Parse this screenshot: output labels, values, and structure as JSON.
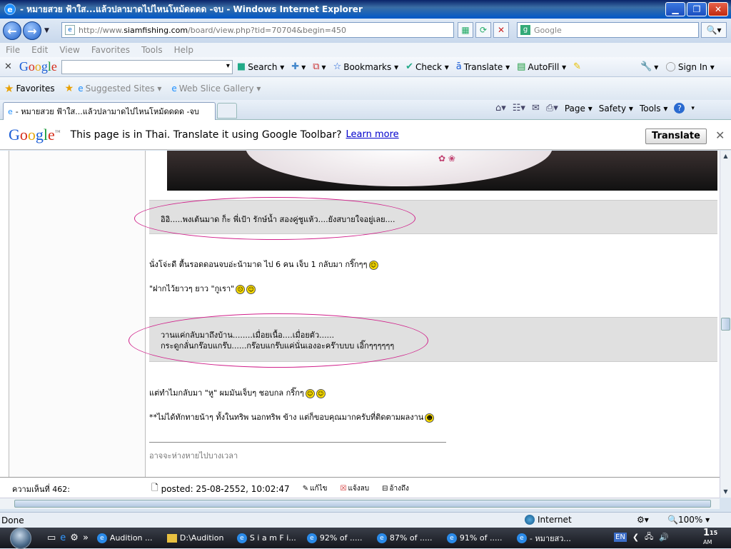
{
  "window": {
    "title": "- หมายสวย ฟ้าใส...แล้วปลามาดไปไหนโหม้ดดดด -จบ - Windows Internet Explorer",
    "controls": {
      "minimize": "▁",
      "maximize": "❐",
      "close": "✕"
    }
  },
  "address": {
    "url_prefix": "http://www.",
    "url_host": "siamfishing.com",
    "url_path": "/board/view.php?tid=70704&begin=450",
    "search_placeholder": "Google"
  },
  "menu": [
    "File",
    "Edit",
    "View",
    "Favorites",
    "Tools",
    "Help"
  ],
  "google_toolbar": {
    "search_label": "Search",
    "bookmarks_label": "Bookmarks",
    "check_label": "Check",
    "translate_label": "Translate",
    "autofill_label": "AutoFill",
    "signin_label": "Sign In"
  },
  "favorites_bar": {
    "favorites_label": "Favorites",
    "suggested_label": "Suggested Sites",
    "webslice_label": "Web Slice Gallery"
  },
  "tab": {
    "label": "- หมายสวย ฟ้าใส...แล้วปลามาดไปไหนโหม้ดดดด -จบ"
  },
  "command_bar": {
    "page_label": "Page",
    "safety_label": "Safety",
    "tools_label": "Tools"
  },
  "translate_bar": {
    "message": "This page is in Thai.  Translate it using Google Toolbar?",
    "learn_more": "Learn more",
    "button": "Translate"
  },
  "post": {
    "quote1": "อิอิ.....พงเต้นมาด ก็ะ พี่เป้า รักษ์น้ำ สองคู่ชูแห้ว....ยังสบายใจอยู่เลย....",
    "para1": "นั่งโจ่ะดี ตื้นรอดดอนจบอ่ะน้ามาด  ไป 6 คน เจ็บ 1 กลับมา กริ๊กๆๆ",
    "para2": "\"ฝากไว้ยาวๆ ยาว \"กูเรา\"",
    "quote2_line1": "วานแค่กลับมาถึงบ้าน........เมื่อยเนื้อ....เมื่อยตัว......",
    "quote2_line2": "กระดูกลั่นกร๊อบแกร๊บ......กร๊อบแกร๊บแค่นั่นเองอะคร๊าบบบ เอิ๊กๆๆๆๆๆๆ",
    "para3": "แต่ทำไมกลับมา \"หู\" ผมมันเจ็บๆ ชอบกล กริ๊กๆ",
    "para4": "**ไม่ได้ทักทายน้าๆ ทั้งในทริพ นอกทริพ ข้าง แต่ก็ขอบคุณมากครับที่ติดตามผลงาน",
    "signature": "อาจจะห่างหายไปบางเวลา",
    "score": "ความเห็นที่ 462:",
    "posted": "posted: 25-08-2552, 10:02:47",
    "edit": "แก้ไข",
    "report": "แจ้งลบ",
    "quote": "อ้างถึง"
  },
  "status": {
    "left": "Done",
    "zone": "Internet",
    "zoom": "100%"
  },
  "taskbar": {
    "items": [
      "Audition ...",
      "D:\\Audition",
      "S i a m F i...",
      "92% of .....",
      "87% of .....",
      "91% of .....",
      "- หมายสว..."
    ],
    "lang": "EN",
    "time_hour": "1",
    "time_min": "15",
    "time_ampm": "AM"
  }
}
